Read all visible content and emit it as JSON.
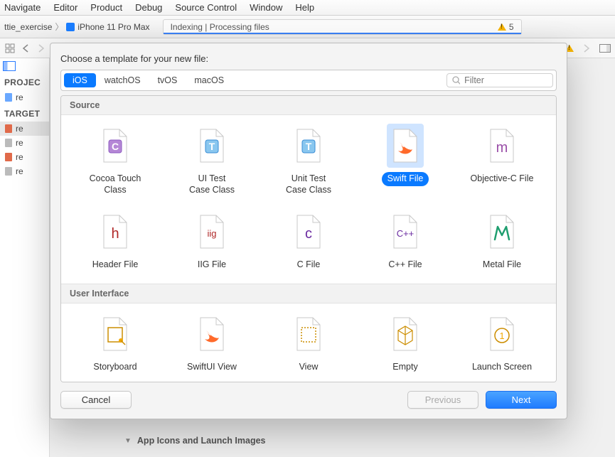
{
  "menubar": [
    "Navigate",
    "Editor",
    "Product",
    "Debug",
    "Source Control",
    "Window",
    "Help"
  ],
  "breadcrumb": {
    "project": "ttie_exercise",
    "device": "iPhone 11 Pro Max"
  },
  "tab": {
    "text": "Indexing | Processing files",
    "warn_count": "5"
  },
  "left": {
    "section1": "PROJEC",
    "items1": [
      "re"
    ],
    "section2": "TARGET",
    "items2": [
      "re",
      "re",
      "re",
      "re"
    ]
  },
  "bottom": {
    "disclosure": "▼",
    "label": "App Icons and Launch Images"
  },
  "sheet": {
    "title": "Choose a template for your new file:",
    "platforms": [
      "iOS",
      "watchOS",
      "tvOS",
      "macOS"
    ],
    "active_platform": 0,
    "filter_placeholder": "Filter",
    "groups": [
      {
        "name": "Source",
        "items": [
          {
            "id": "cocoa-touch-class",
            "label": "Cocoa Touch\nClass",
            "glyph": "C",
            "fill": "#b587d6",
            "stroke": "#8d5bc0"
          },
          {
            "id": "ui-test-case-class",
            "label": "UI Test\nCase Class",
            "glyph": "T",
            "fill": "#8ac7ef",
            "stroke": "#3a8ed6"
          },
          {
            "id": "unit-test-case-class",
            "label": "Unit Test\nCase Class",
            "glyph": "T",
            "fill": "#8ac7ef",
            "stroke": "#3a8ed6"
          },
          {
            "id": "swift-file",
            "label": "Swift File",
            "glyph": "swift",
            "fill": "#ff6a2b",
            "stroke": "#e2571e",
            "selected": true
          },
          {
            "id": "objective-c-file",
            "label": "Objective-C File",
            "glyph": "m",
            "fill": "#9a4ea8",
            "stroke": "#7a398a",
            "serif": true
          },
          {
            "id": "header-file",
            "label": "Header File",
            "glyph": "h",
            "fill": "#b02828",
            "stroke": "#8a1e1e",
            "serif": true
          },
          {
            "id": "iig-file",
            "label": "IIG File",
            "glyph": "iig",
            "fill": "#b02828",
            "stroke": "#8a1e1e",
            "serif": true,
            "small": true
          },
          {
            "id": "c-file",
            "label": "C File",
            "glyph": "c",
            "fill": "#6a2aa0",
            "stroke": "#521f80",
            "serif": true
          },
          {
            "id": "cpp-file",
            "label": "C++ File",
            "glyph": "C++",
            "fill": "#6a2aa0",
            "stroke": "#521f80",
            "serif": true,
            "small": true
          },
          {
            "id": "metal-file",
            "label": "Metal File",
            "glyph": "M",
            "fill": "#2bc48b",
            "stroke": "#1f9e6f"
          }
        ]
      },
      {
        "name": "User Interface",
        "items": [
          {
            "id": "storyboard",
            "label": "Storyboard",
            "glyph": "sb",
            "fill": "#f2a800",
            "stroke": "#cc8d00"
          },
          {
            "id": "swiftui-view",
            "label": "SwiftUI View",
            "glyph": "swift",
            "fill": "#ff6a2b",
            "stroke": "#e2571e"
          },
          {
            "id": "view",
            "label": "View",
            "glyph": "view",
            "fill": "#f2a800",
            "stroke": "#cc8d00"
          },
          {
            "id": "empty",
            "label": "Empty",
            "glyph": "cube",
            "fill": "#f2a800",
            "stroke": "#cc8d00"
          },
          {
            "id": "launch-screen",
            "label": "Launch Screen",
            "glyph": "1",
            "fill": "#f2a800",
            "stroke": "#cc8d00"
          }
        ]
      }
    ],
    "buttons": {
      "cancel": "Cancel",
      "previous": "Previous",
      "next": "Next"
    }
  }
}
